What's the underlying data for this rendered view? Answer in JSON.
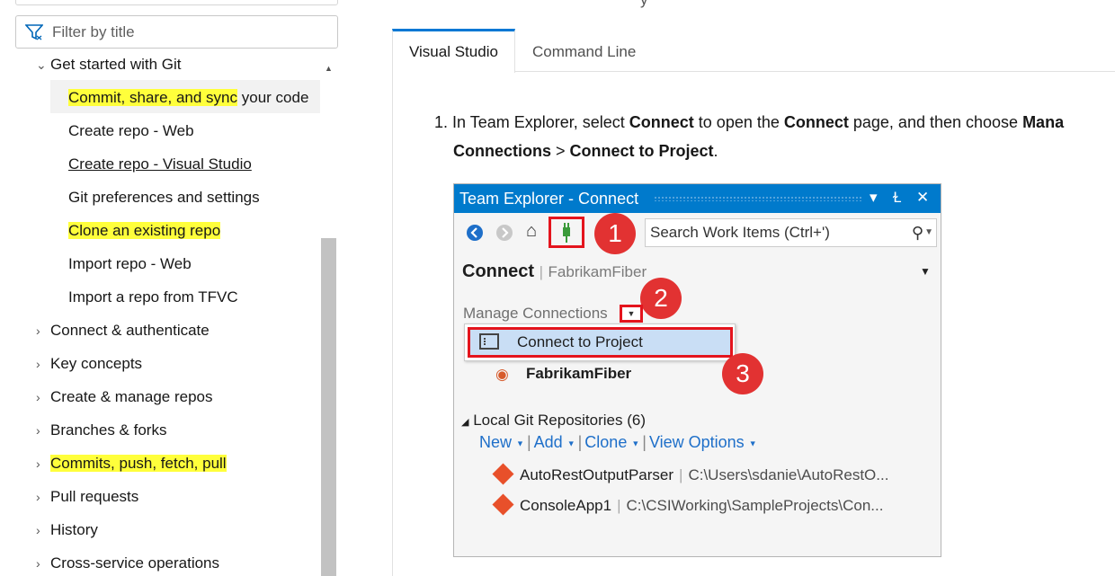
{
  "nav": {
    "filter_placeholder": "Filter by title",
    "items": [
      {
        "label": "Get started with Git",
        "expanded": true
      },
      {
        "label_hl": "Commit, share, and sync",
        "label_rest": " your code",
        "active": true
      },
      {
        "label": "Create repo - Web"
      },
      {
        "label": "Create repo - Visual Studio",
        "underlined": true
      },
      {
        "label": "Git preferences and settings"
      },
      {
        "label": "Clone an existing repo",
        "highlighted": true
      },
      {
        "label": "Import repo - Web"
      },
      {
        "label": "Import a repo from TFVC"
      },
      {
        "label": "Connect & authenticate"
      },
      {
        "label": "Key concepts"
      },
      {
        "label": "Create & manage repos"
      },
      {
        "label": "Branches & forks"
      },
      {
        "label": "Commits, push, fetch, pull",
        "highlighted": true
      },
      {
        "label": "Pull requests"
      },
      {
        "label": "History"
      },
      {
        "label": "Cross-service operations"
      }
    ]
  },
  "main": {
    "top_cut_text": "y",
    "tabs": [
      "Visual Studio",
      "Command Line"
    ],
    "step": {
      "number": "1.",
      "part1": "In Team Explorer, select ",
      "b1": "Connect",
      "part2": " to open the ",
      "b2": "Connect",
      "part3": " page, and then choose ",
      "b3": "Mana",
      "b4": "Connections",
      "part4": " > ",
      "b5": "Connect to Project",
      "part5": "."
    }
  },
  "team_explorer": {
    "title": "Team Explorer - Connect",
    "title_controls": {
      "dropdown": "▾",
      "pin": "Ɫ",
      "close": "✕"
    },
    "search_placeholder": "Search Work Items (Ctrl+')",
    "connect_label": "Connect",
    "connect_project": "FabrikamFiber",
    "manage_connections": "Manage Connections",
    "menu_item": "Connect to Project",
    "project": "FabrikamFiber",
    "local_repos": "Local Git Repositories (6)",
    "links": [
      "New",
      "Add",
      "Clone",
      "View Options"
    ],
    "repos": [
      {
        "name": "AutoRestOutputParser",
        "path": "C:\\Users\\sdanie\\AutoRestO..."
      },
      {
        "name": "ConsoleApp1",
        "path": "C:\\CSIWorking\\SampleProjects\\Con..."
      }
    ],
    "markers": [
      "1",
      "2",
      "3"
    ],
    "colors": {
      "titlebar": "#007acc",
      "callout": "#e4141d",
      "marker": "#e23232",
      "link": "#1e6fc9",
      "menu_highlight": "#c9def5"
    }
  }
}
